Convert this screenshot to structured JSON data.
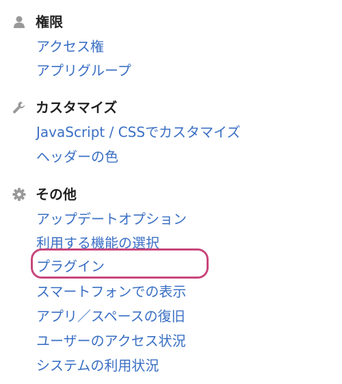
{
  "sections": [
    {
      "title": "権限",
      "icon": "user-icon",
      "links": [
        "アクセス権",
        "アプリグループ"
      ]
    },
    {
      "title": "カスタマイズ",
      "icon": "wrench-icon",
      "links": [
        "JavaScript / CSSでカスタマイズ",
        "ヘッダーの色"
      ]
    },
    {
      "title": "その他",
      "icon": "gear-icon",
      "links": [
        "アップデートオプション",
        "利用する機能の選択",
        "プラグイン",
        "スマートフォンでの表示",
        "アプリ／スペースの復旧",
        "ユーザーのアクセス状況",
        "システムの利用状況"
      ]
    }
  ],
  "highlighted_link": "プラグイン",
  "colors": {
    "link": "#3a6fc4",
    "title": "#222222",
    "icon": "#999999",
    "highlight": "#c8457a"
  }
}
